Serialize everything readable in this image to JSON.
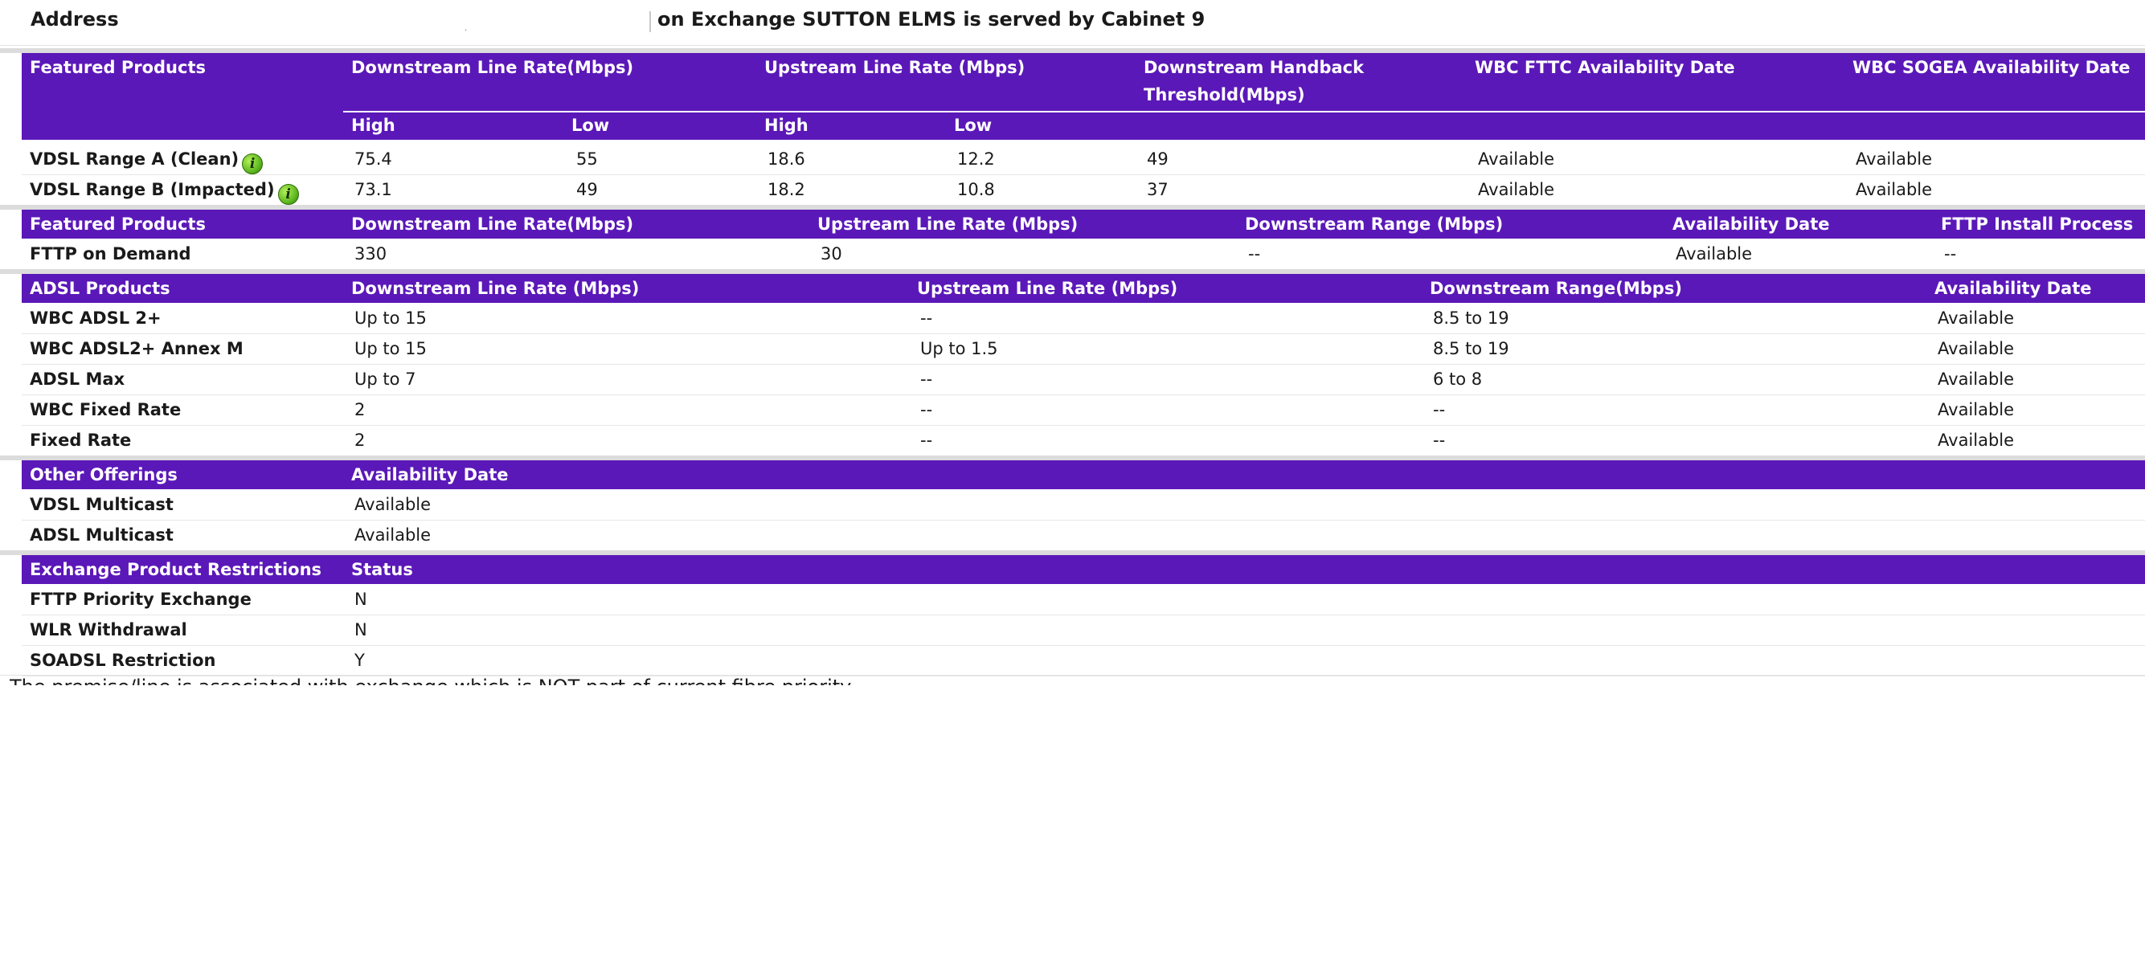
{
  "address": {
    "label": "Address",
    "value_placeholder": ".",
    "exchange_text": "on Exchange SUTTON ELMS is served by Cabinet 9"
  },
  "vdsl": {
    "headers": {
      "product": "Featured Products",
      "downstream": "Downstream Line Rate(Mbps)",
      "upstream": "Upstream Line Rate (Mbps)",
      "handback_line1": "Downstream Handback",
      "handback_line2": "Threshold(Mbps)",
      "fttc_date": "WBC FTTC Availability Date",
      "sogea_date": "WBC SOGEA Availability Date",
      "high": "High",
      "low": "Low"
    },
    "rows": [
      {
        "name": "VDSL Range A (Clean)",
        "icon": "info-icon",
        "down_high": "75.4",
        "down_low": "55",
        "up_high": "18.6",
        "up_low": "12.2",
        "handback": "49",
        "fttc": "Available",
        "sogea": "Available"
      },
      {
        "name": "VDSL Range B (Impacted)",
        "icon": "info-icon",
        "down_high": "73.1",
        "down_low": "49",
        "up_high": "18.2",
        "up_low": "10.8",
        "handback": "37",
        "fttc": "Available",
        "sogea": "Available"
      }
    ]
  },
  "fttp": {
    "headers": {
      "product": "Featured Products",
      "downstream": "Downstream Line Rate(Mbps)",
      "upstream": "Upstream Line Rate (Mbps)",
      "range": "Downstream Range (Mbps)",
      "date": "Availability Date",
      "install": "FTTP Install Process"
    },
    "rows": [
      {
        "name": "FTTP on Demand",
        "down": "330",
        "up": "30",
        "range": "--",
        "date": "Available",
        "install": "--"
      }
    ]
  },
  "adsl": {
    "headers": {
      "product": "ADSL Products",
      "downstream": "Downstream Line Rate (Mbps)",
      "upstream": "Upstream Line Rate (Mbps)",
      "range": "Downstream Range(Mbps)",
      "date": "Availability Date"
    },
    "rows": [
      {
        "name": "WBC ADSL 2+",
        "down": "Up to 15",
        "up": "--",
        "range": "8.5 to 19",
        "date": "Available"
      },
      {
        "name": "WBC ADSL2+ Annex M",
        "down": "Up to 15",
        "up": "Up to 1.5",
        "range": "8.5 to 19",
        "date": "Available"
      },
      {
        "name": "ADSL Max",
        "down": "Up to 7",
        "up": "--",
        "range": "6 to 8",
        "date": "Available"
      },
      {
        "name": "WBC Fixed Rate",
        "down": "2",
        "up": "--",
        "range": "--",
        "date": "Available"
      },
      {
        "name": "Fixed Rate",
        "down": "2",
        "up": "--",
        "range": "--",
        "date": "Available"
      }
    ]
  },
  "other": {
    "headers": {
      "product": "Other Offerings",
      "date": "Availability Date"
    },
    "rows": [
      {
        "name": "VDSL Multicast",
        "date": "Available"
      },
      {
        "name": "ADSL Multicast",
        "date": "Available"
      }
    ]
  },
  "restrictions": {
    "headers": {
      "product": "Exchange Product Restrictions",
      "status": "Status"
    },
    "rows": [
      {
        "name": "FTTP Priority Exchange",
        "status": "N"
      },
      {
        "name": "WLR Withdrawal",
        "status": "N"
      },
      {
        "name": "SOADSL Restriction",
        "status": "Y"
      }
    ]
  },
  "footnote": "The premise/line is associated with exchange which is NOT part of current fibre priority programme",
  "colors": {
    "header_bg": "#5b18b8",
    "header_text": "#ffffff",
    "row_border": "#e6e6e6",
    "separator": "#dcdcdc"
  }
}
